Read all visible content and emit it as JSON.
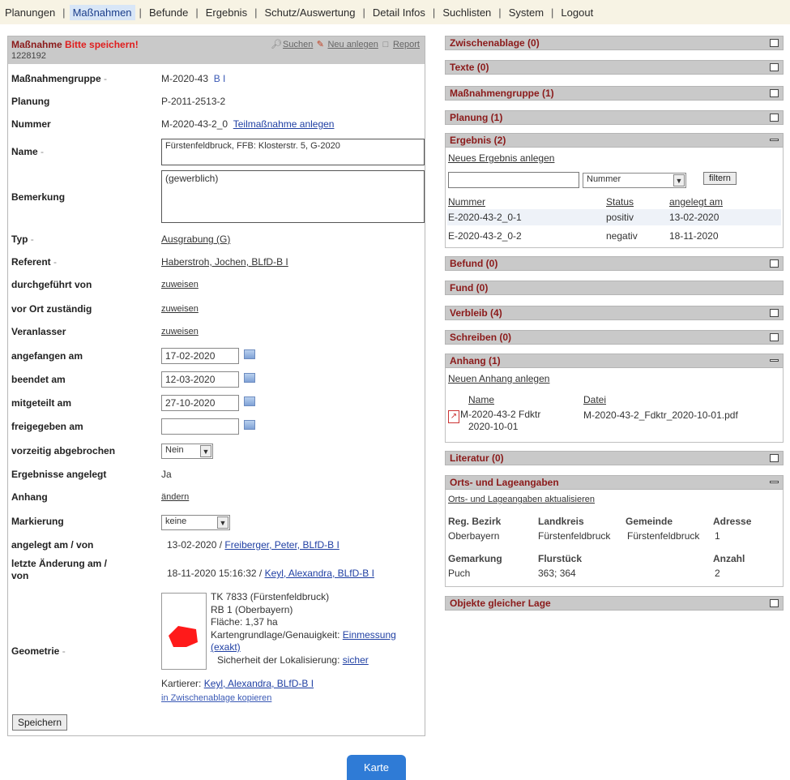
{
  "nav": [
    {
      "label": "Planungen",
      "active": false
    },
    {
      "label": "Maßnahmen",
      "active": true
    },
    {
      "label": "Befunde",
      "active": false
    },
    {
      "label": "Ergebnis",
      "active": false
    },
    {
      "label": "Schutz/Auswertung",
      "active": false
    },
    {
      "label": "Detail Infos",
      "active": false
    },
    {
      "label": "Suchlisten",
      "active": false
    },
    {
      "label": "System",
      "active": false
    },
    {
      "label": "Logout",
      "active": false
    }
  ],
  "left": {
    "title": "Maßnahme",
    "warning": "Bitte speichern!",
    "id": "1228192",
    "tools": {
      "search": "Suchen",
      "new": "Neu anlegen",
      "report": "Report"
    },
    "massnahmengruppe": {
      "label": "Maßnahmengruppe",
      "value": "M-2020-43",
      "suffix": "B I"
    },
    "planung": {
      "label": "Planung",
      "value": "P-2011-2513-2"
    },
    "nummer": {
      "label": "Nummer",
      "value": "M-2020-43-2_0",
      "link": "Teilmaßnahme anlegen"
    },
    "name": {
      "label": "Name",
      "value": "Fürstenfeldbruck, FFB: Klosterstr. 5, G-2020"
    },
    "bemerkung": {
      "label": "Bemerkung",
      "value": "(gewerblich)"
    },
    "typ": {
      "label": "Typ",
      "value": "Ausgrabung (G)"
    },
    "referent": {
      "label": "Referent",
      "value": "Haberstroh, Jochen, BLfD-B I"
    },
    "durchgefuehrt": {
      "label": "durchgeführt von",
      "value": "zuweisen"
    },
    "vorort": {
      "label": "vor Ort zuständig",
      "value": "zuweisen"
    },
    "veranlasser": {
      "label": "Veranlasser",
      "value": "zuweisen"
    },
    "angefangen": {
      "label": "angefangen am",
      "value": "17-02-2020"
    },
    "beendet": {
      "label": "beendet am",
      "value": "12-03-2020"
    },
    "mitgeteilt": {
      "label": "mitgeteilt am",
      "value": "27-10-2020"
    },
    "freigegeben": {
      "label": "freigegeben am",
      "value": ""
    },
    "vorzeitig": {
      "label": "vorzeitig abgebrochen",
      "value": "Nein"
    },
    "ergebnisse": {
      "label": "Ergebnisse angelegt",
      "value": "Ja"
    },
    "anhang": {
      "label": "Anhang",
      "value": "ändern"
    },
    "markierung": {
      "label": "Markierung",
      "value": "keine"
    },
    "angelegt": {
      "label": "angelegt am / von",
      "date": "13-02-2020 /",
      "user": "Freiberger, Peter, BLfD-B I"
    },
    "letzte": {
      "label1": "letzte Änderung am /",
      "label2": "von",
      "date": "18-11-2020 15:16:32 /",
      "user": "Keyl, Alexandra, BLfD-B I"
    },
    "geometrie": {
      "label": "Geometrie",
      "tk": "TK 7833 (Fürstenfeldbruck)",
      "rb": "RB 1 (Oberbayern)",
      "flaeche": "Fläche: 1,37 ha",
      "karten_label": "Kartengrundlage/Genauigkeit:",
      "karten_value": "Einmessung",
      "karten_value2": "(exakt)",
      "sicherheit_label": "Sicherheit der Lokalisierung:",
      "sicherheit_value": "sicher",
      "kartierer_label": "Kartierer:",
      "kartierer_value": "Keyl, Alexandra, BLfD-B I",
      "copy": "in Zwischenablage kopieren"
    },
    "save": "Speichern"
  },
  "right": {
    "zwischenablage": "Zwischenablage (0)",
    "texte": "Texte (0)",
    "massnahmengruppe": "Maßnahmengruppe (1)",
    "planung": "Planung (1)",
    "ergebnis": {
      "title": "Ergebnis (2)",
      "new_link": "Neues Ergebnis anlegen",
      "filter_select": "Nummer",
      "filter_btn": "filtern",
      "headers": [
        "Nummer",
        "Status",
        "angelegt am"
      ],
      "rows": [
        {
          "nummer": "E-2020-43-2_0-1",
          "status": "positiv",
          "date": "13-02-2020"
        },
        {
          "nummer": "E-2020-43-2_0-2",
          "status": "negativ",
          "date": "18-11-2020"
        }
      ]
    },
    "befund": "Befund (0)",
    "fund": "Fund (0)",
    "verbleib": "Verbleib (4)",
    "schreiben": "Schreiben (0)",
    "anhang": {
      "title": "Anhang (1)",
      "new_link": "Neuen Anhang anlegen",
      "headers": [
        "Name",
        "Datei"
      ],
      "name1": "M-2020-43-2 Fdktr",
      "name2": "2020-10-01",
      "datei": "M-2020-43-2_Fdktr_2020-10-01.pdf"
    },
    "literatur": "Literatur (0)",
    "orts": {
      "title": "Orts- und Lageangaben",
      "update_link": "Orts- und Lageangaben aktualisieren",
      "h1": [
        "Reg. Bezirk",
        "Landkreis",
        "Gemeinde",
        "Adresse"
      ],
      "r1": [
        "Oberbayern",
        "Fürstenfeldbruck",
        "Fürstenfeldbruck",
        "1"
      ],
      "h2": [
        "Gemarkung",
        "Flurstück",
        "Anzahl"
      ],
      "r2": [
        "Puch",
        "363; 364",
        "2"
      ]
    },
    "objekte": "Objekte gleicher Lage"
  },
  "karte": "Karte"
}
